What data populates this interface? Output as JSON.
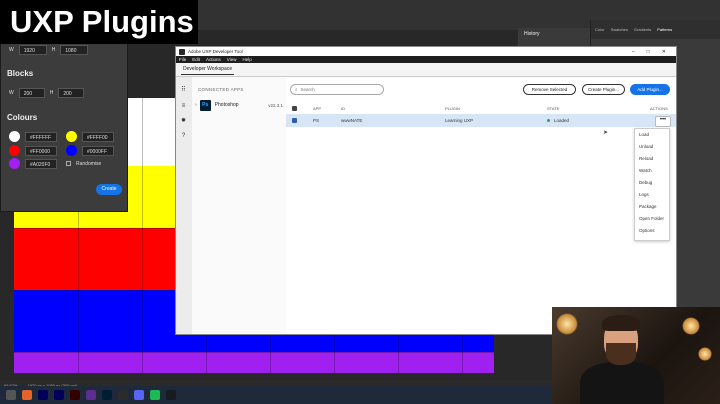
{
  "video_title": "UXP Plugins",
  "photoshop": {
    "zoom_readout": "66.67%",
    "doc_info": "1920 px x 1080 px (300 ppi)",
    "panel_tabs": [
      "Color",
      "Swatches",
      "Gradients",
      "Patterns"
    ],
    "history_label": "History"
  },
  "plugin_panel": {
    "size_w_label": "W",
    "size_w_value": "1920",
    "size_h_label": "H",
    "size_h_value": "1080",
    "blocks_heading": "Blocks",
    "blocks_w_label": "W",
    "blocks_w_value": "200",
    "blocks_h_label": "H",
    "blocks_h_value": "200",
    "colours_heading": "Colours",
    "colours": [
      {
        "hex": "#FFFFFF"
      },
      {
        "hex": "#FFFF00"
      },
      {
        "hex": "#FF0000"
      },
      {
        "hex": "#0000FF"
      },
      {
        "hex": "#A020F0"
      }
    ],
    "randomise_label": "Randomise",
    "create_label": "Create"
  },
  "uxp_tool": {
    "window_title": "Adobe UXP Developer Tool",
    "menu": [
      "File",
      "Edit",
      "Actions",
      "View",
      "Help"
    ],
    "workspace_tab": "Developer Workspace",
    "connected_apps_label": "CONNECTED APPS",
    "app": {
      "name": "Photoshop",
      "version": "v22.3.1",
      "icon_text": "Ps"
    },
    "search_placeholder": "Search",
    "remove_selected_label": "Remove Selected",
    "create_plugin_label": "Create Plugin...",
    "add_plugin_label": "Add Plugin...",
    "columns": {
      "app": "APP",
      "id": "ID",
      "plugin": "PLUGIN",
      "state": "STATE",
      "actions": "ACTIONS"
    },
    "rows": [
      {
        "app": "PS",
        "id": "wwwNATE",
        "plugin": "Learning UXP",
        "state": "Loaded"
      }
    ],
    "actions_menu": [
      "Load",
      "Unload",
      "Reload",
      "Watch",
      "Debug",
      "Logs",
      "Package",
      "Open Folder",
      "Options"
    ]
  },
  "colors": {
    "accent_blue": "#1473e6",
    "selected_row": "#d6e6f7",
    "loaded_green": "#2d9d78"
  }
}
